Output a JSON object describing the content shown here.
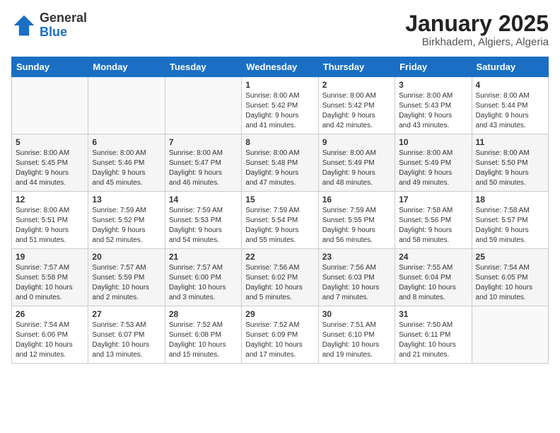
{
  "logo": {
    "general": "General",
    "blue": "Blue"
  },
  "title": "January 2025",
  "subtitle": "Birkhadem, Algiers, Algeria",
  "days": [
    "Sunday",
    "Monday",
    "Tuesday",
    "Wednesday",
    "Thursday",
    "Friday",
    "Saturday"
  ],
  "weeks": [
    [
      {
        "day": "",
        "text": ""
      },
      {
        "day": "",
        "text": ""
      },
      {
        "day": "",
        "text": ""
      },
      {
        "day": "1",
        "text": "Sunrise: 8:00 AM\nSunset: 5:42 PM\nDaylight: 9 hours\nand 41 minutes."
      },
      {
        "day": "2",
        "text": "Sunrise: 8:00 AM\nSunset: 5:42 PM\nDaylight: 9 hours\nand 42 minutes."
      },
      {
        "day": "3",
        "text": "Sunrise: 8:00 AM\nSunset: 5:43 PM\nDaylight: 9 hours\nand 43 minutes."
      },
      {
        "day": "4",
        "text": "Sunrise: 8:00 AM\nSunset: 5:44 PM\nDaylight: 9 hours\nand 43 minutes."
      }
    ],
    [
      {
        "day": "5",
        "text": "Sunrise: 8:00 AM\nSunset: 5:45 PM\nDaylight: 9 hours\nand 44 minutes."
      },
      {
        "day": "6",
        "text": "Sunrise: 8:00 AM\nSunset: 5:46 PM\nDaylight: 9 hours\nand 45 minutes."
      },
      {
        "day": "7",
        "text": "Sunrise: 8:00 AM\nSunset: 5:47 PM\nDaylight: 9 hours\nand 46 minutes."
      },
      {
        "day": "8",
        "text": "Sunrise: 8:00 AM\nSunset: 5:48 PM\nDaylight: 9 hours\nand 47 minutes."
      },
      {
        "day": "9",
        "text": "Sunrise: 8:00 AM\nSunset: 5:49 PM\nDaylight: 9 hours\nand 48 minutes."
      },
      {
        "day": "10",
        "text": "Sunrise: 8:00 AM\nSunset: 5:49 PM\nDaylight: 9 hours\nand 49 minutes."
      },
      {
        "day": "11",
        "text": "Sunrise: 8:00 AM\nSunset: 5:50 PM\nDaylight: 9 hours\nand 50 minutes."
      }
    ],
    [
      {
        "day": "12",
        "text": "Sunrise: 8:00 AM\nSunset: 5:51 PM\nDaylight: 9 hours\nand 51 minutes."
      },
      {
        "day": "13",
        "text": "Sunrise: 7:59 AM\nSunset: 5:52 PM\nDaylight: 9 hours\nand 52 minutes."
      },
      {
        "day": "14",
        "text": "Sunrise: 7:59 AM\nSunset: 5:53 PM\nDaylight: 9 hours\nand 54 minutes."
      },
      {
        "day": "15",
        "text": "Sunrise: 7:59 AM\nSunset: 5:54 PM\nDaylight: 9 hours\nand 55 minutes."
      },
      {
        "day": "16",
        "text": "Sunrise: 7:59 AM\nSunset: 5:55 PM\nDaylight: 9 hours\nand 56 minutes."
      },
      {
        "day": "17",
        "text": "Sunrise: 7:58 AM\nSunset: 5:56 PM\nDaylight: 9 hours\nand 58 minutes."
      },
      {
        "day": "18",
        "text": "Sunrise: 7:58 AM\nSunset: 5:57 PM\nDaylight: 9 hours\nand 59 minutes."
      }
    ],
    [
      {
        "day": "19",
        "text": "Sunrise: 7:57 AM\nSunset: 5:58 PM\nDaylight: 10 hours\nand 0 minutes."
      },
      {
        "day": "20",
        "text": "Sunrise: 7:57 AM\nSunset: 5:59 PM\nDaylight: 10 hours\nand 2 minutes."
      },
      {
        "day": "21",
        "text": "Sunrise: 7:57 AM\nSunset: 6:00 PM\nDaylight: 10 hours\nand 3 minutes."
      },
      {
        "day": "22",
        "text": "Sunrise: 7:56 AM\nSunset: 6:02 PM\nDaylight: 10 hours\nand 5 minutes."
      },
      {
        "day": "23",
        "text": "Sunrise: 7:56 AM\nSunset: 6:03 PM\nDaylight: 10 hours\nand 7 minutes."
      },
      {
        "day": "24",
        "text": "Sunrise: 7:55 AM\nSunset: 6:04 PM\nDaylight: 10 hours\nand 8 minutes."
      },
      {
        "day": "25",
        "text": "Sunrise: 7:54 AM\nSunset: 6:05 PM\nDaylight: 10 hours\nand 10 minutes."
      }
    ],
    [
      {
        "day": "26",
        "text": "Sunrise: 7:54 AM\nSunset: 6:06 PM\nDaylight: 10 hours\nand 12 minutes."
      },
      {
        "day": "27",
        "text": "Sunrise: 7:53 AM\nSunset: 6:07 PM\nDaylight: 10 hours\nand 13 minutes."
      },
      {
        "day": "28",
        "text": "Sunrise: 7:52 AM\nSunset: 6:08 PM\nDaylight: 10 hours\nand 15 minutes."
      },
      {
        "day": "29",
        "text": "Sunrise: 7:52 AM\nSunset: 6:09 PM\nDaylight: 10 hours\nand 17 minutes."
      },
      {
        "day": "30",
        "text": "Sunrise: 7:51 AM\nSunset: 6:10 PM\nDaylight: 10 hours\nand 19 minutes."
      },
      {
        "day": "31",
        "text": "Sunrise: 7:50 AM\nSunset: 6:11 PM\nDaylight: 10 hours\nand 21 minutes."
      },
      {
        "day": "",
        "text": ""
      }
    ]
  ]
}
